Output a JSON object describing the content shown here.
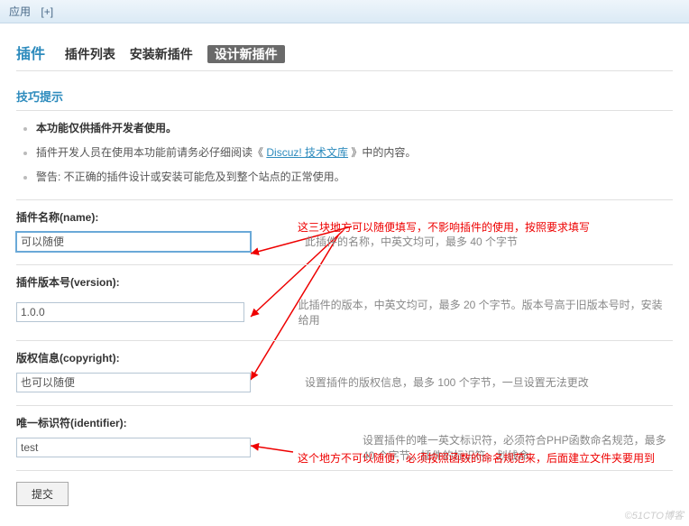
{
  "topbar": {
    "app": "应用",
    "plus": "[+]"
  },
  "nav": {
    "title": "插件",
    "tabs": [
      "插件列表",
      "安装新插件"
    ],
    "active": "设计新插件"
  },
  "tips": {
    "header": "技巧提示",
    "items": [
      "本功能仅供插件开发者使用。",
      "插件开发人员在使用本功能前请务必仔细阅读《",
      "》中的内容。",
      "警告: 不正确的插件设计或安装可能危及到整个站点的正常使用。"
    ],
    "link": "Discuz! 技术文库"
  },
  "fields": {
    "name": {
      "label": "插件名称(name):",
      "value": "可以随便",
      "hint": "此插件的名称，中英文均可，最多 40 个字节"
    },
    "version": {
      "label": "插件版本号(version):",
      "value": "1.0.0",
      "hint": "此插件的版本，中英文均可，最多 20 个字节。版本号高于旧版本号时，安装给用"
    },
    "copyright": {
      "label": "版权信息(copyright):",
      "value": "也可以随便",
      "hint": "设置插件的版权信息，最多 100 个字节，一旦设置无法更改"
    },
    "identifier": {
      "label": "唯一标识符(identifier):",
      "value": "test",
      "hint": "设置插件的唯一英文标识符，必须符合PHP函数命名规范，最多 40 个字节。插件的标识符、划线命"
    }
  },
  "annotations": {
    "top": "这三块地方可以随便填写，不影响插件的使用，按照要求填写",
    "bottom": "这个地方不可以随便，必须按照函数的命名规范来，后面建立文件夹要用到"
  },
  "submit": "提交",
  "watermark": "©51CTO博客"
}
